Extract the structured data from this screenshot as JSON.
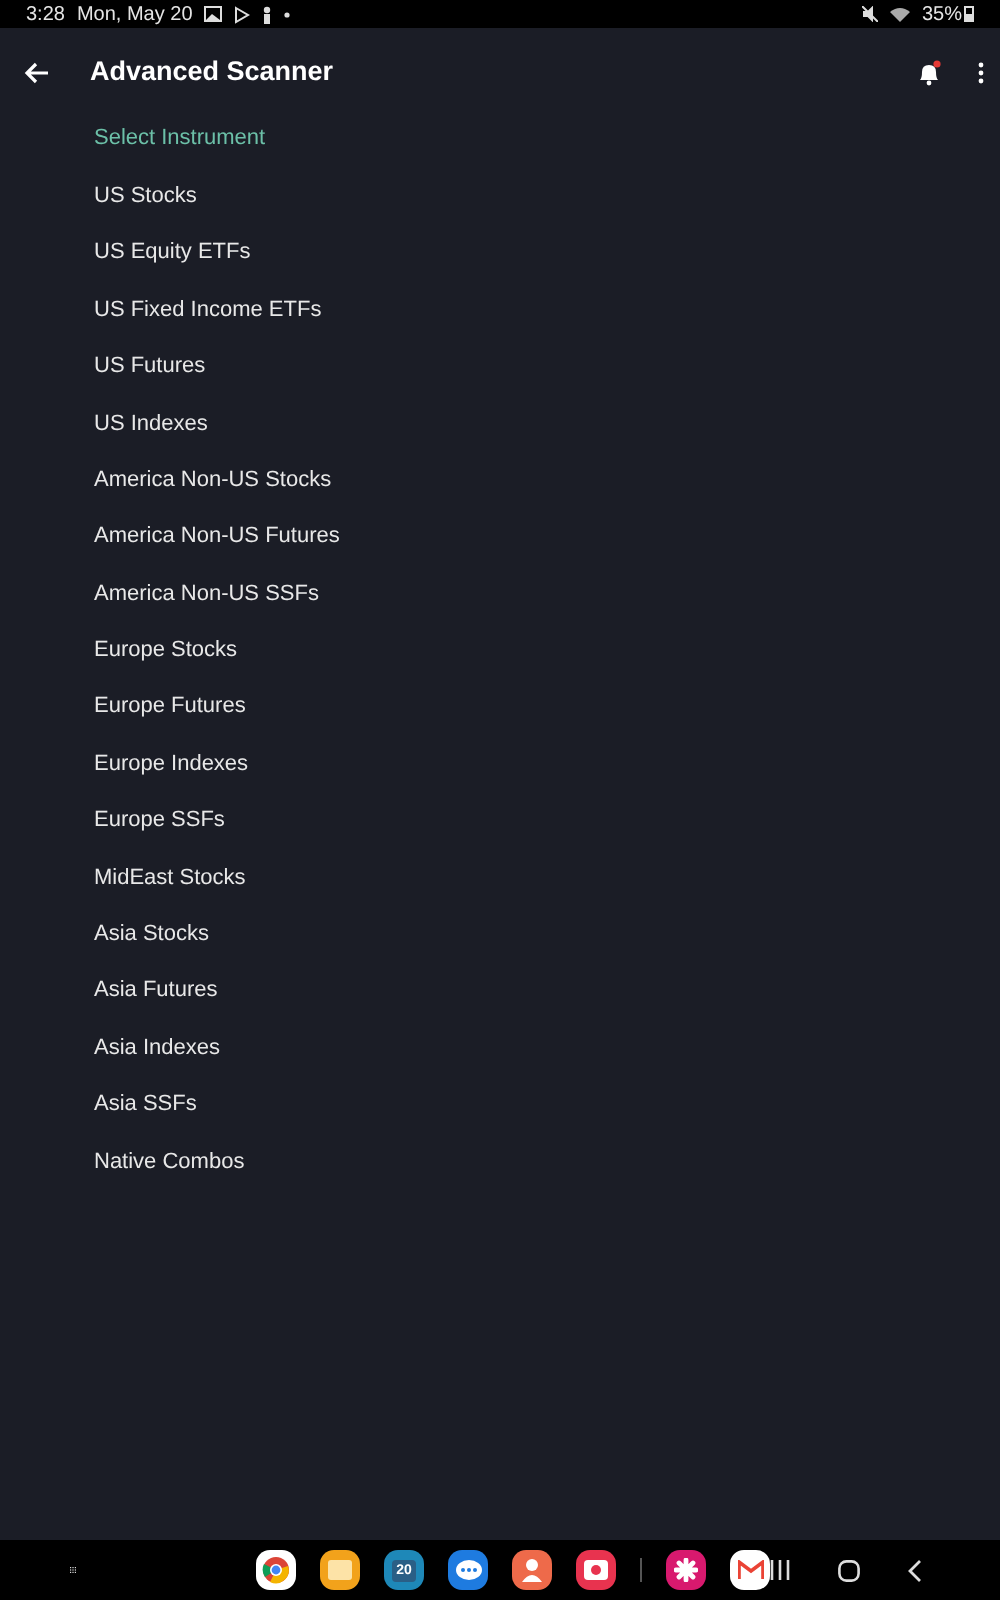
{
  "status_bar": {
    "time": "3:28",
    "date": "Mon, May 20",
    "battery": "35%"
  },
  "app_bar": {
    "title": "Advanced Scanner",
    "bell_alert": true
  },
  "section_title": "Select Instrument",
  "items": [
    "US Stocks",
    "US Equity ETFs",
    "US Fixed Income ETFs",
    "US Futures",
    "US Indexes",
    "America Non-US Stocks",
    "America Non-US Futures",
    "America Non-US SSFs",
    "Europe Stocks",
    "Europe Futures",
    "Europe Indexes",
    "Europe SSFs",
    "MidEast Stocks",
    "Asia Stocks",
    "Asia Futures",
    "Asia Indexes",
    "Asia SSFs",
    "Native Combos"
  ],
  "dock": [
    {
      "kind": "browser"
    },
    {
      "kind": "files"
    },
    {
      "kind": "calendar",
      "label": "20"
    },
    {
      "kind": "messages"
    },
    {
      "kind": "contacts"
    },
    {
      "kind": "camera"
    },
    {
      "kind": "divider"
    },
    {
      "kind": "flower"
    },
    {
      "kind": "mail"
    }
  ]
}
